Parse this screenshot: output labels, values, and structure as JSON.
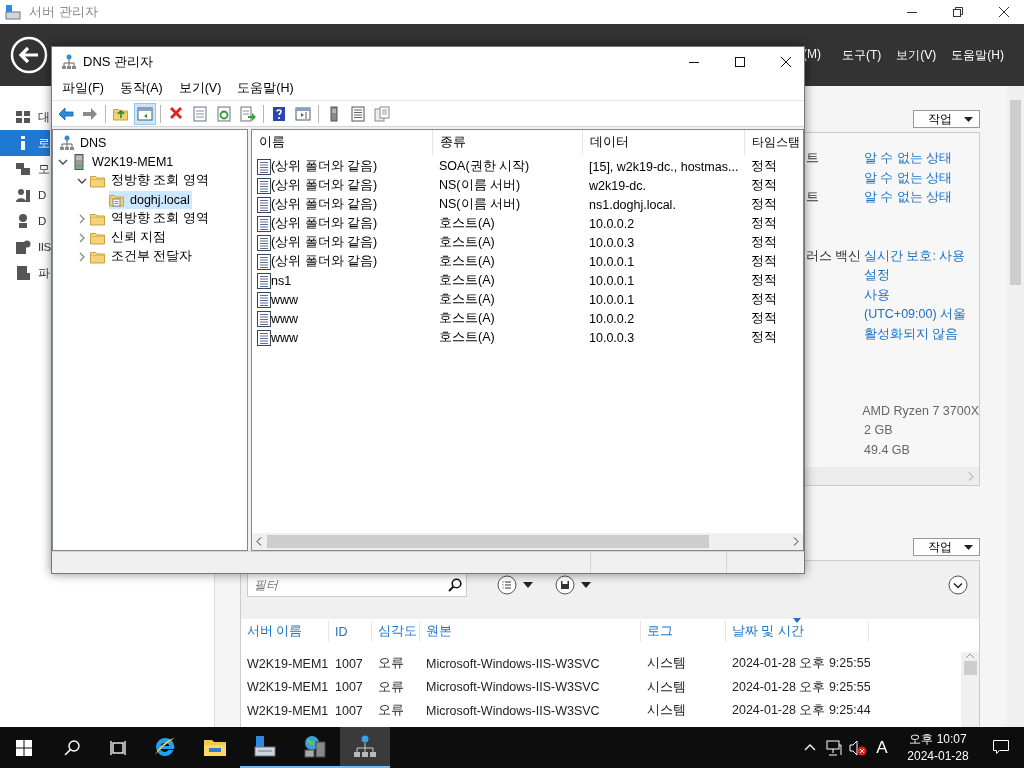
{
  "server_manager": {
    "title": "서버 관리자",
    "menu": [
      "(M)",
      "도구(T)",
      "보기(V)",
      "도움말(H)"
    ],
    "sidebar": [
      {
        "label": "대",
        "selected": false
      },
      {
        "label": "로",
        "selected": true
      },
      {
        "label": "모",
        "selected": false
      },
      {
        "label": "D",
        "selected": false
      },
      {
        "label": "D",
        "selected": false
      },
      {
        "label": "IIS",
        "selected": false
      },
      {
        "label": "파",
        "selected": false
      }
    ],
    "properties": {
      "action": "작업",
      "groups": [
        {
          "rows": [
            {
              "label": "트",
              "value": "알 수 없는 상태",
              "kind": "link"
            },
            {
              "value": "알 수 없는 상태",
              "kind": "link"
            },
            {
              "label": "트",
              "value": "알 수 없는 상태",
              "kind": "link"
            }
          ]
        },
        {
          "rows": [
            {
              "label": "러스 백신",
              "value": "실시간 보호: 사용",
              "kind": "link"
            },
            {
              "value": "설정",
              "kind": "link"
            },
            {
              "value": "사용",
              "kind": "link"
            },
            {
              "value": "(UTC+09:00) 서울",
              "kind": "link"
            },
            {
              "value": "활성화되지 않음",
              "kind": "link"
            }
          ]
        },
        {
          "rows": [
            {
              "value": "AMD Ryzen 7 3700X",
              "kind": "text"
            },
            {
              "value": "2 GB",
              "kind": "text"
            },
            {
              "value": "49.4 GB",
              "kind": "text"
            }
          ]
        }
      ]
    },
    "events": {
      "action": "작업",
      "filter_placeholder": "필터",
      "columns": [
        {
          "label": "서버 이름",
          "sorted": false
        },
        {
          "label": "ID",
          "sorted": false
        },
        {
          "label": "심각도",
          "sorted": false
        },
        {
          "label": "원본",
          "sorted": false
        },
        {
          "label": "로그",
          "sorted": false
        },
        {
          "label": "날짜 및 시간",
          "sorted": true
        }
      ],
      "rows": [
        [
          "W2K19-MEM1",
          "1007",
          "오류",
          "Microsoft-Windows-IIS-W3SVC",
          "시스템",
          "2024-01-28 오후 9:25:55"
        ],
        [
          "W2K19-MEM1",
          "1007",
          "오류",
          "Microsoft-Windows-IIS-W3SVC",
          "시스템",
          "2024-01-28 오후 9:25:55"
        ],
        [
          "W2K19-MEM1",
          "1007",
          "오류",
          "Microsoft-Windows-IIS-W3SVC",
          "시스템",
          "2024-01-28 오후 9:25:44"
        ]
      ]
    }
  },
  "dns_manager": {
    "title": "DNS 관리자",
    "menu": [
      "파일(F)",
      "동작(A)",
      "보기(V)",
      "도움말(H)"
    ],
    "toolbar": [
      {
        "pressed": false
      },
      {
        "pressed": false
      },
      {
        "pressed": false
      },
      {
        "pressed": true
      },
      {
        "pressed": false
      },
      {
        "pressed": false
      },
      {
        "pressed": false
      },
      {
        "pressed": false
      },
      {
        "pressed": false
      },
      {
        "pressed": false
      },
      {
        "pressed": false
      },
      {
        "pressed": false
      },
      {
        "pressed": false
      }
    ],
    "tree": [
      {
        "label": "DNS",
        "kind": "dns",
        "selected": false,
        "children": [
          {
            "label": "W2K19-MEM1",
            "kind": "server",
            "expanded": true,
            "selected": false,
            "children": [
              {
                "label": "정방향 조회 영역",
                "kind": "folder",
                "expanded": true,
                "selected": false,
                "children": [
                  {
                    "label": "doghj.local",
                    "kind": "zone",
                    "selected": true
                  }
                ]
              },
              {
                "label": "역방향 조회 영역",
                "kind": "folder",
                "expanded": false,
                "selected": false
              },
              {
                "label": "신뢰 지점",
                "kind": "folder",
                "expanded": false,
                "selected": false
              },
              {
                "label": "조건부 전달자",
                "kind": "folder",
                "expanded": false,
                "selected": false
              }
            ]
          }
        ]
      }
    ],
    "columns": [
      "이름",
      "종류",
      "데이터",
      "타임스탬"
    ],
    "rows": [
      [
        "(상위 폴더와 같음)",
        "SOA(권한 시작)",
        "[15], w2k19-dc., hostmas...",
        "정적"
      ],
      [
        "(상위 폴더와 같음)",
        "NS(이름 서버)",
        "w2k19-dc.",
        "정적"
      ],
      [
        "(상위 폴더와 같음)",
        "NS(이름 서버)",
        "ns1.doghj.local.",
        "정적"
      ],
      [
        "(상위 폴더와 같음)",
        "호스트(A)",
        "10.0.0.2",
        "정적"
      ],
      [
        "(상위 폴더와 같음)",
        "호스트(A)",
        "10.0.0.3",
        "정적"
      ],
      [
        "(상위 폴더와 같음)",
        "호스트(A)",
        "10.0.0.1",
        "정적"
      ],
      [
        "ns1",
        "호스트(A)",
        "10.0.0.1",
        "정적"
      ],
      [
        "www",
        "호스트(A)",
        "10.0.0.1",
        "정적"
      ],
      [
        "www",
        "호스트(A)",
        "10.0.0.2",
        "정적"
      ],
      [
        "www",
        "호스트(A)",
        "10.0.0.3",
        "정적"
      ]
    ]
  },
  "taskbar": {
    "apps": [
      {
        "running": false,
        "active": false
      },
      {
        "running": false,
        "active": false
      },
      {
        "running": true,
        "active": false
      },
      {
        "running": true,
        "active": false
      },
      {
        "running": true,
        "active": true
      }
    ],
    "ime": "A",
    "time": "오후 10:07",
    "date": "2024-01-28"
  }
}
